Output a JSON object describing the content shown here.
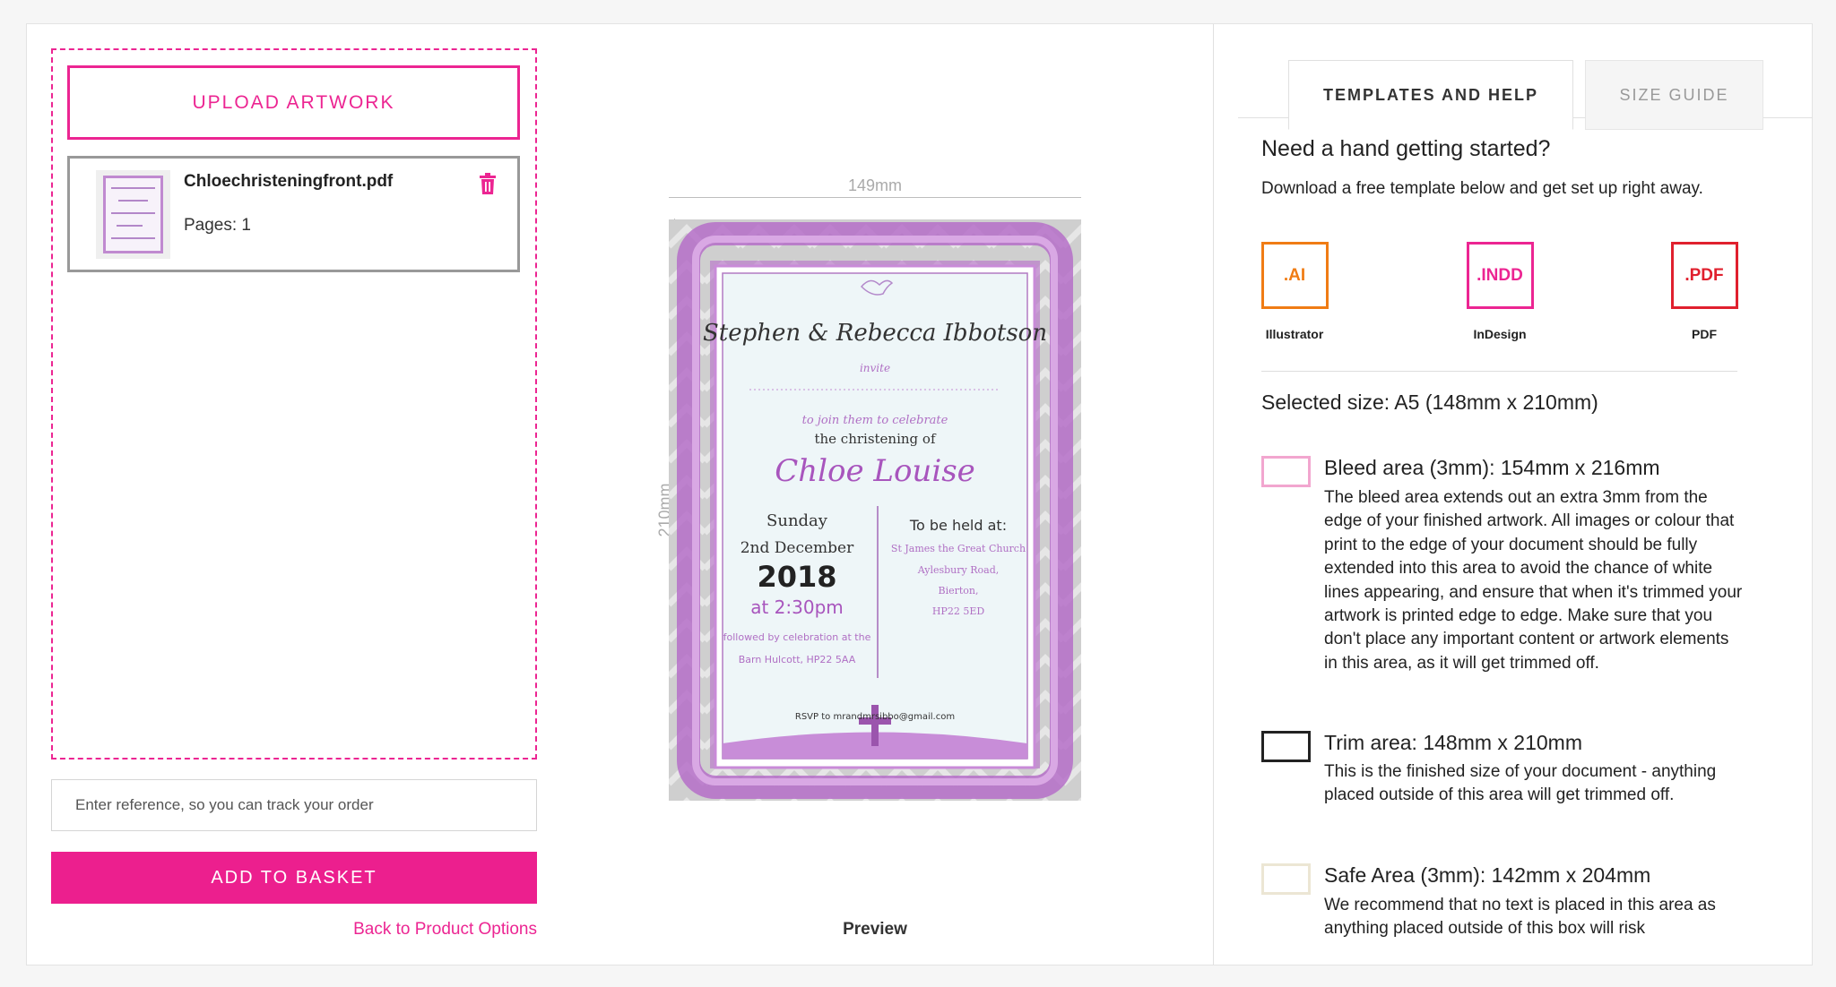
{
  "upload": {
    "button_label": "UPLOAD ARTWORK",
    "file_name": "Chloechristeningfront.pdf",
    "pages": "Pages: 1"
  },
  "order": {
    "reference_placeholder": "Enter reference, so you can track your order",
    "add_to_basket": "ADD TO BASKET",
    "back_link": "Back to Product Options"
  },
  "preview": {
    "width_label": "149mm",
    "height_label": "210mm",
    "label": "Preview",
    "invite": {
      "names": "Stephen & Rebecca Ibbotson",
      "invite_word": "invite",
      "join_text": "to join them to celebrate",
      "christening_text": "the christening of",
      "child_name": "Chloe Louise",
      "day": "Sunday",
      "date": "2nd December",
      "year": "2018",
      "time": "at 2:30pm",
      "followed_1": "followed by celebration at the",
      "followed_2": "Barn Hulcott, HP22 5AA",
      "held_at": "To be held at:",
      "venue_1": "St James the Great Church",
      "venue_2": "Aylesbury Road,",
      "venue_3": "Bierton,",
      "venue_4": "HP22 5ED",
      "rsvp": "RSVP to mrandmrsibbo@gmail.com"
    }
  },
  "help": {
    "tabs": [
      "TEMPLATES AND HELP",
      "SIZE GUIDE"
    ],
    "title": "Need a hand getting started?",
    "subtitle": "Download a free template below and get set up right away.",
    "templates": [
      {
        "ext": ".AI",
        "label": "Illustrator",
        "color": "#f07c14"
      },
      {
        "ext": ".INDD",
        "label": "InDesign",
        "color": "#ec2592"
      },
      {
        "ext": ".PDF",
        "label": "PDF",
        "color": "#e0202e"
      }
    ],
    "selected_size": "Selected size: A5 (148mm x 210mm)",
    "areas": [
      {
        "title": "Bleed area (3mm): 154mm x 216mm",
        "color": "#f2a6cf",
        "description": "The bleed area extends out an extra 3mm from the edge of your finished artwork. All images or colour that print to the edge of your document should be fully extended into this area to avoid the chance of white lines appearing, and ensure that when it's trimmed your artwork is printed edge to edge. Make sure that you don't place any important content or artwork elements in this area, as it will get trimmed off."
      },
      {
        "title": "Trim area: 148mm x 210mm",
        "color": "#222222",
        "description": "This is the finished size of your document - anything placed outside of this area will get trimmed off."
      },
      {
        "title": "Safe Area (3mm): 142mm x 204mm",
        "color": "#ece6d4",
        "description": "We recommend that no text is placed in this area as anything placed outside of this box will risk"
      }
    ]
  }
}
